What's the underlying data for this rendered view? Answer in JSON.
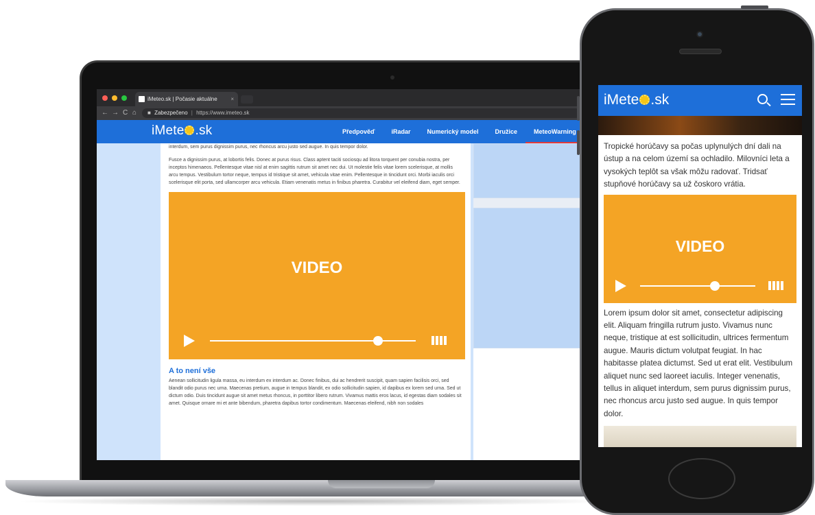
{
  "browser": {
    "tab_title": "iMeteo.sk | Počasie aktuálne",
    "tab_close": "×",
    "nav_back": "←",
    "nav_forward": "→",
    "nav_reload": "C",
    "nav_home": "⌂",
    "lock_icon": "🔒",
    "secure_label": "Zabezpečeno",
    "separator": "|",
    "url": "https://www.imeteo.sk"
  },
  "site": {
    "logo_left": "iMete",
    "logo_right": ".sk",
    "nav": [
      "Předpověď",
      "iRadar",
      "Numerický model",
      "Družice",
      "MeteoWarning"
    ],
    "paragraphs": [
      "interdum, sem purus dignissim purus, nec rhoncus arcu justo sed augue. In quis tempor dolor.",
      "Fusce a dignissim purus, at lobortis felis. Donec at purus risus. Class aptent taciti sociosqu ad litora torquent per conubia nostra, per inceptos himenaeos. Pellentesque vitae nisl at enim sagittis rutrum sit amet nec dui. Ut molestie felis vitae lorem scelerisque, at mollis arcu tempus. Vestibulum tortor neque, tempus id tristique sit amet, vehicula vitae enim. Pellentesque in tincidunt orci. Morbi iaculis orci scelerisque elit porta, sed ullamcorper arcu vehicula. Etiam venenatis metus in finibus pharetra. Curabitur vel eleifend diam, eget semper."
    ],
    "video_label": "VIDEO",
    "section_heading": "A to není vše",
    "section_text": "Aenean sollicitudin ligula massa, eu interdum ex interdum ac. Donec finibus, dui ac hendrerit suscipit, quam sapien facilisis orci, sed blandit odio purus nec urna. Maecenas pretium, augue in tempus blandit, ex odio sollicitudin sapien, id dapibus ex lorem sed urna. Sed ut dictum odio. Duis tincidunt augue sit amet metus rhoncus, in porttitor libero rutrum. Vivamus mattis eros lacus, id egestas diam sodales sit amet. Quisque ornare mi et ante bibendum, pharetra dapibus tortor condimentum. Maecenas eleifend, nibh non sodales"
  },
  "mobile": {
    "logo_left": "iMete",
    "logo_right": ".sk",
    "intro": "Tropické horúčavy sa počas uplynulých dní dali na ústup a na celom území sa ochladilo. Milovníci leta a vysokých teplôt sa však môžu radovať. Tridsať stupňové horúčavy sa už čoskoro vrátia.",
    "video_label": "VIDEO",
    "body": "Lorem ipsum dolor sit amet, consectetur adipiscing elit. Aliquam fringilla rutrum justo. Vivamus nunc neque, tristique at est sollicitudin, ultrices fermentum augue. Mauris dictum volutpat feugiat. In hac habitasse platea dictumst. Sed ut erat elit. Vestibulum aliquet nunc sed laoreet iaculis. Integer venenatis, tellus in aliquet interdum, sem purus dignissim purus, nec rhoncus arcu justo sed augue. In quis tempor dolor."
  },
  "colors": {
    "brand_blue": "#1e6fd9",
    "video_orange": "#f4a425",
    "sidebar_blue": "#cfe3fb",
    "active_underline": "#e33b3b"
  },
  "icons": [
    "play-icon",
    "volume-icon",
    "search-icon",
    "hamburger-menu-icon",
    "lock-icon",
    "sun-logo-icon"
  ]
}
